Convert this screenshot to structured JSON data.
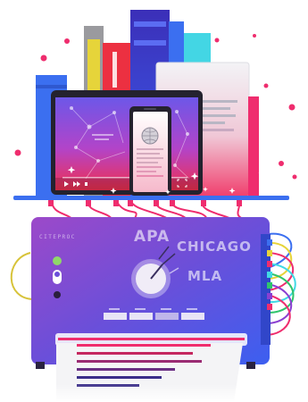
{
  "machine": {
    "brand": "CITEPROC",
    "dial_styles": [
      "APA",
      "CHICAGO",
      "MLA"
    ]
  },
  "colors": {
    "pink_accent": "#ef2d6e",
    "purple": "#8a3fd1",
    "blue": "#3a5ae6",
    "shelf_blue": "#3b6ff0",
    "cyan": "#41d9e4"
  },
  "icons": [
    "wikipedia-globe-icon",
    "play-icon",
    "fast-forward-icon",
    "volume-icon",
    "fullscreen-icon",
    "sparkle-icon",
    "dial-knob-icon"
  ]
}
